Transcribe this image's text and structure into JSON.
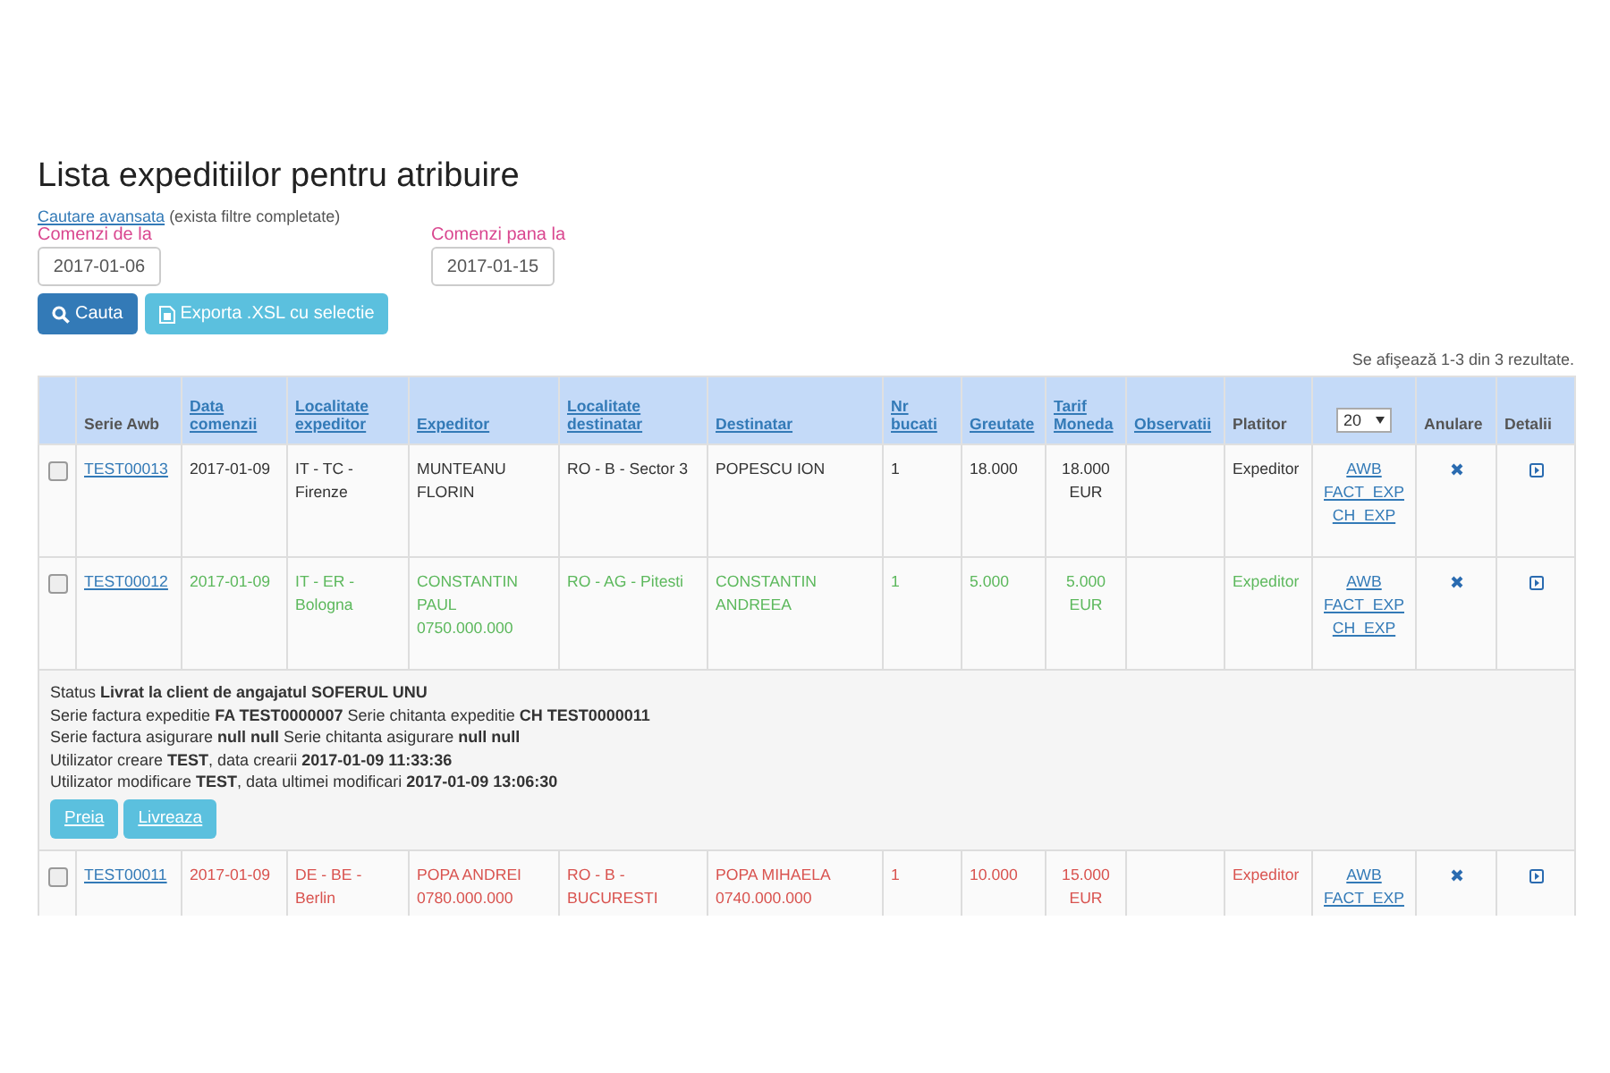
{
  "title": "Lista expeditiilor pentru atribuire",
  "advanced_search": {
    "link": "Cautare avansata",
    "note": "(exista filtre completate)"
  },
  "filters": [
    {
      "label": "Comenzi de la",
      "value": "2017-01-06"
    },
    {
      "label": "Comenzi pana la",
      "value": "2017-01-15"
    }
  ],
  "buttons": [
    {
      "label": "Cauta",
      "kind": "primary"
    },
    {
      "label": "Exporta .XSL cu selectie",
      "kind": "info"
    }
  ],
  "summary": "Se afişează 1-3 din 3 rezultate.",
  "table": {
    "columns": [
      {
        "kind": "checkbox"
      },
      {
        "label": "Serie Awb",
        "kind": "text"
      },
      {
        "label": "Data comenzii",
        "kind": "link"
      },
      {
        "label": "Localitate expeditor",
        "kind": "link"
      },
      {
        "label": "Expeditor",
        "kind": "link"
      },
      {
        "label": "Localitate destinatar",
        "kind": "link"
      },
      {
        "label": "Destinatar",
        "kind": "link"
      },
      {
        "label": "Nr bucati",
        "kind": "link"
      },
      {
        "label": "Greutate",
        "kind": "link"
      },
      {
        "label": "Tarif Moneda",
        "kind": "link"
      },
      {
        "label": "Observatii",
        "kind": "link"
      },
      {
        "label": "Platitor",
        "kind": "text"
      },
      {
        "label": "20",
        "kind": "select"
      },
      {
        "label": "Anulare",
        "kind": "text"
      },
      {
        "label": "Detalii",
        "kind": "text"
      }
    ],
    "rows": [
      {
        "checked": false,
        "color": "#333333",
        "serie": "TEST00013",
        "data": "2017-01-09",
        "loc_exp": "IT - TC - Firenze",
        "expeditor": "MUNTEANU FLORIN",
        "loc_dest": "RO - B - Sector 3",
        "destinatar": "POPESCU ION",
        "nr": "1",
        "greutate": "18.000",
        "tarif": "18.000 EUR",
        "platitor": "Expeditor",
        "documents": [
          "AWB",
          "FACT_EXP",
          "CH_EXP"
        ]
      },
      {
        "checked": false,
        "color": "#5cb85c",
        "serie": "TEST00012",
        "data": "2017-01-09",
        "loc_exp": "IT - ER - Bologna",
        "expeditor": "CONSTANTIN PAUL 0750.000.000",
        "loc_dest": "RO - AG - Pitesti",
        "destinatar": "CONSTANTIN ANDREEA",
        "nr": "1",
        "greutate": "5.000",
        "tarif": "5.000 EUR",
        "platitor": "Expeditor",
        "documents": [
          "AWB",
          "FACT_EXP",
          "CH_EXP"
        ],
        "details": {
          "lines": [
            "Status **Livrat la client de angajatul SOFERUL UNU**",
            "Serie factura expeditie **FA TEST0000007** Serie chitanta expeditie **CH TEST0000011**",
            "Serie factura asigurare **null null** Serie chitanta asigurare **null null**",
            "Utilizator creare **TEST**, data crearii **2017-01-09 11:33:36**",
            "Utilizator modificare **TEST**, data ultimei modificari **2017-01-09 13:06:30**"
          ],
          "actions": [
            "Preia",
            "Livreaza"
          ]
        }
      },
      {
        "checked": false,
        "color": "#d9534f",
        "serie": "TEST00011",
        "data": "2017-01-09",
        "loc_exp": "DE - BE - Berlin",
        "expeditor": "POPA ANDREI 0780.000.000",
        "loc_dest": "RO - B - BUCURESTI",
        "destinatar": "POPA MIHAELA 0740.000.000",
        "nr": "1",
        "greutate": "10.000",
        "tarif": "15.000 EUR",
        "platitor": "Expeditor",
        "documents": [
          "AWB",
          "FACT_EXP"
        ]
      }
    ]
  }
}
